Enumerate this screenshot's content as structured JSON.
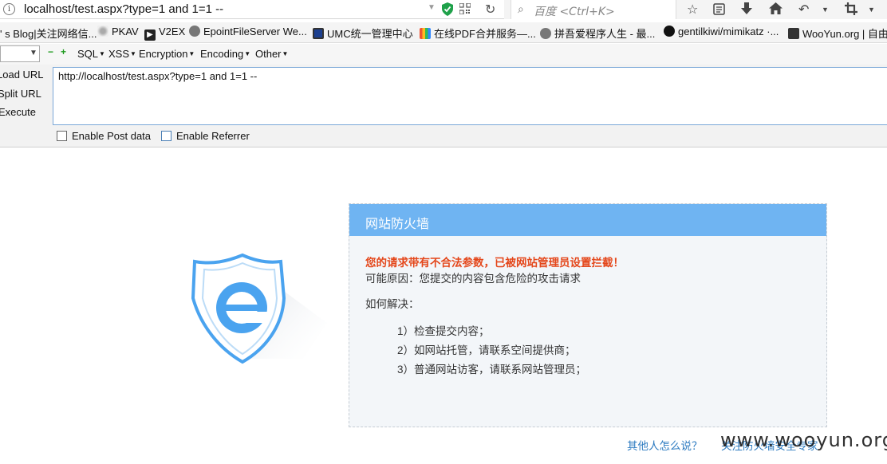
{
  "browser": {
    "url": "localhost/test.aspx?type=1 and 1=1 --",
    "search_placeholder": "百度 <Ctrl+K>"
  },
  "bookmarks": [
    {
      "label": "' s Blog|关注网络信...",
      "icon": "blog-icon"
    },
    {
      "label": "PKAV",
      "icon": "pkav-icon"
    },
    {
      "label": "V2EX",
      "icon": "v2ex-icon"
    },
    {
      "label": "EpointFileServer We...",
      "icon": "globe-icon"
    },
    {
      "label": "UMC统一管理中心",
      "icon": "monitor-icon"
    },
    {
      "label": "在线PDF合并服务—...",
      "icon": "pdf-icon"
    },
    {
      "label": "拼吾爱程序人生 - 最...",
      "icon": "globe-icon"
    },
    {
      "label": "gentilkiwi/mimikatz ·...",
      "icon": "github-icon"
    },
    {
      "label": "WooYun.org | 自由",
      "icon": "wooyun-icon"
    }
  ],
  "hackbar": {
    "menus": [
      "SQL",
      "XSS",
      "Encryption",
      "Encoding",
      "Other"
    ],
    "actions": [
      "Load URL",
      "Split URL",
      "Execute"
    ],
    "url_value": "http://localhost/test.aspx?type=1 and 1=1 --",
    "enable_post": "Enable Post data",
    "enable_referrer": "Enable Referrer"
  },
  "firewall": {
    "title": "网站防火墙",
    "warning": "您的请求带有不合法参数，已被网站管理员设置拦截！",
    "reason": "可能原因：您提交的内容包含危险的攻击请求",
    "how_title": "如何解决：",
    "steps": [
      "1）检查提交内容；",
      "2）如网站托管，请联系空间提供商；",
      "3）普通网站访客，请联系网站管理员；"
    ],
    "link_others": "其他人怎么说？",
    "link_follow": "关注防火墙安全专家"
  },
  "watermark": "www.wooyun.org",
  "colors": {
    "header_blue": "#6fb4f2",
    "warning_red": "#e4471b",
    "link_blue": "#2f7cc1",
    "logo_blue": "#4aa3ef"
  }
}
